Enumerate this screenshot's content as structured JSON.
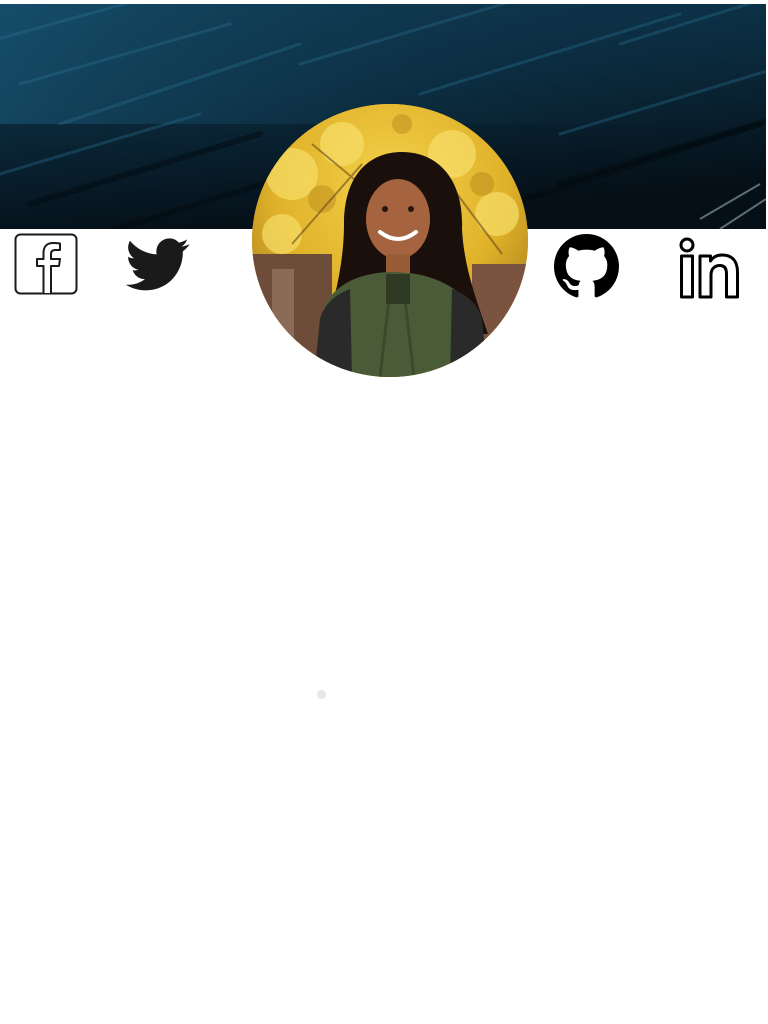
{
  "profile": {
    "avatar_icon": "profile-photo"
  },
  "social_links": [
    {
      "network": "facebook",
      "icon": "facebook-icon"
    },
    {
      "network": "twitter",
      "icon": "twitter-icon"
    },
    {
      "network": "github",
      "icon": "github-icon"
    },
    {
      "network": "linkedin",
      "icon": "linkedin-icon"
    }
  ],
  "colors": {
    "banner_dark": "#06141e",
    "banner_teal": "#0e3a52",
    "icon_color": "#1a1a1a",
    "background": "#ffffff"
  }
}
